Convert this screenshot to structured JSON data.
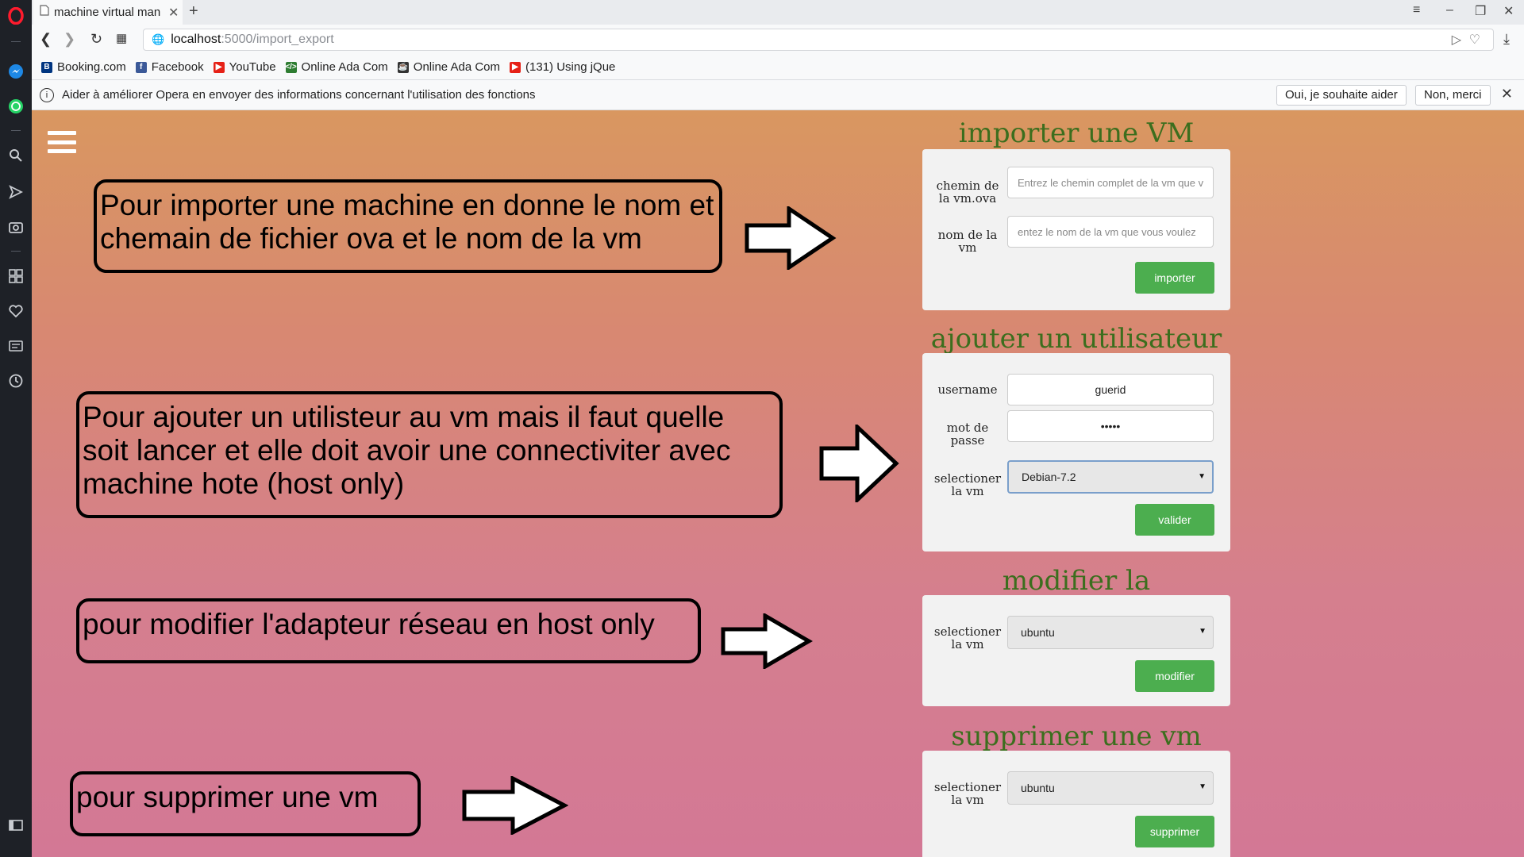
{
  "browser": {
    "tab_title": "machine virtual man",
    "url_host": "localhost",
    "url_path": ":5000/import_export",
    "bookmarks": [
      {
        "label": "Booking.com",
        "color": "#003580",
        "glyph": "B"
      },
      {
        "label": "Facebook",
        "color": "#3b5998",
        "glyph": "f"
      },
      {
        "label": "YouTube",
        "color": "#e62117",
        "glyph": "▶"
      },
      {
        "label": "Online Ada Com",
        "color": "#2e7d32",
        "glyph": "</>"
      },
      {
        "label": "Online Ada Com",
        "color": "#333333",
        "glyph": "☕"
      },
      {
        "label": "(131) Using jQue",
        "color": "#e62117",
        "glyph": "▶"
      }
    ],
    "infobar": {
      "message": "Aider à améliorer Opera en envoyer des informations concernant l'utilisation des fonctions",
      "accept_label": "Oui, je souhaite aider",
      "decline_label": "Non, merci"
    }
  },
  "notes": {
    "import": "Pour importer une machine en donne le nom et chemain de fichier ova et le nom de la vm",
    "add_user": "Pour ajouter un utilisteur au vm mais il faut quelle soit lancer et elle doit avoir une connectiviter avec machine hote (host only)",
    "modify": "pour modifier l'adapteur réseau en host only",
    "delete": "pour supprimer une vm"
  },
  "import_vm": {
    "title": "importer une VM",
    "path_label": "chemin de la vm.ova",
    "path_placeholder": "Entrez le chemin complet de la vm que v",
    "name_label": "nom de la vm",
    "name_placeholder": "entez le nom de la vm que vous voulez",
    "button": "importer"
  },
  "add_user": {
    "title": "ajouter un utilisateur",
    "username_label": "username",
    "username_value": "guerid",
    "password_label": "mot de passe",
    "password_value": "•••••",
    "vm_label": "selectioner la vm",
    "vm_value": "Debian-7.2",
    "button": "valider"
  },
  "modify_config": {
    "title": "modifier la configuration",
    "vm_label": "selectioner la vm",
    "vm_value": "ubuntu",
    "button": "modifier"
  },
  "delete_vm": {
    "title": "supprimer une vm",
    "vm_label": "selectioner la vm",
    "vm_value": "ubuntu",
    "button": "supprimer"
  }
}
